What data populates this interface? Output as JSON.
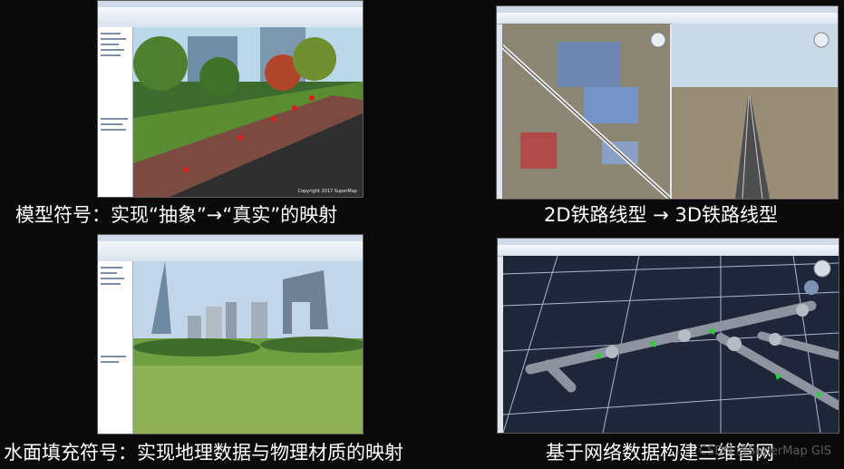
{
  "captions": {
    "top_left": "模型符号：实现“抽象”→“真实”的映射",
    "top_right": "2D铁路线型 → 3D铁路线型",
    "bottom_left": "水面填充符号：实现地理数据与物理材质的映射",
    "bottom_right": "基于网络数据构建三维管网"
  },
  "watermark": "CSDN @SuperMap GIS",
  "screenshots": {
    "model_symbol": {
      "scene": "city-street",
      "copyright": "Copyright 2017 SuperMap"
    },
    "railway": {
      "scene": "railway-2d-3d"
    },
    "water_fill": {
      "scene": "cbd-skyline"
    },
    "pipe_network": {
      "scene": "3d-pipe-network"
    }
  },
  "colors": {
    "background": "#0a0a0a",
    "caption_text": "#ffffff",
    "pipe_arrow": "#2ecc40",
    "grid_line": "#a8b8cc"
  }
}
